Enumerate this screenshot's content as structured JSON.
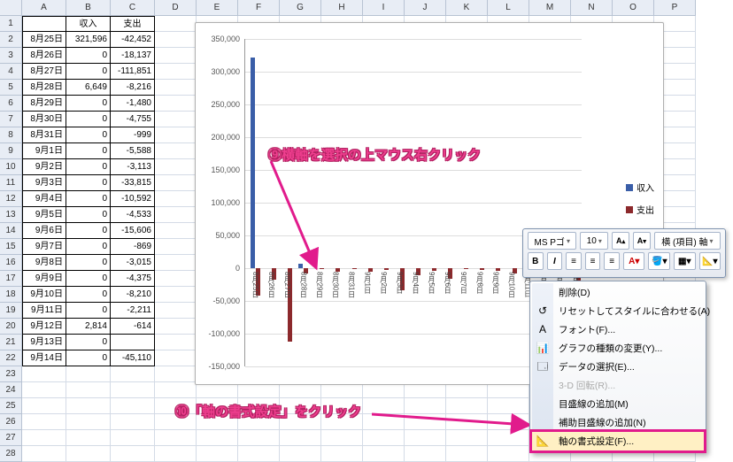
{
  "columns": [
    "A",
    "B",
    "C",
    "D",
    "E",
    "F",
    "G",
    "H",
    "I",
    "J",
    "K",
    "L",
    "M",
    "N",
    "O",
    "P"
  ],
  "row_start": 1,
  "row_end": 28,
  "table": {
    "headers": [
      "",
      "収入",
      "支出"
    ],
    "rows": [
      [
        "8月25日",
        "321,596",
        "-42,452"
      ],
      [
        "8月26日",
        "0",
        "-18,137"
      ],
      [
        "8月27日",
        "0",
        "-111,851"
      ],
      [
        "8月28日",
        "6,649",
        "-8,216"
      ],
      [
        "8月29日",
        "0",
        "-1,480"
      ],
      [
        "8月30日",
        "0",
        "-4,755"
      ],
      [
        "8月31日",
        "0",
        "-999"
      ],
      [
        "9月1日",
        "0",
        "-5,588"
      ],
      [
        "9月2日",
        "0",
        "-3,113"
      ],
      [
        "9月3日",
        "0",
        "-33,815"
      ],
      [
        "9月4日",
        "0",
        "-10,592"
      ],
      [
        "9月5日",
        "0",
        "-4,533"
      ],
      [
        "9月6日",
        "0",
        "-15,606"
      ],
      [
        "9月7日",
        "0",
        "-869"
      ],
      [
        "9月8日",
        "0",
        "-3,015"
      ],
      [
        "9月9日",
        "0",
        "-4,375"
      ],
      [
        "9月10日",
        "0",
        "-8,210"
      ],
      [
        "9月11日",
        "0",
        "-2,211"
      ],
      [
        "9月12日",
        "2,814",
        "-614"
      ],
      [
        "9月13日",
        "0",
        ""
      ],
      [
        "9月14日",
        "0",
        "-45,110"
      ]
    ]
  },
  "legend": {
    "income": "収入",
    "expense": "支出"
  },
  "minitoolbar": {
    "font_name": "MS Pゴ",
    "font_size": "10",
    "axis_label": "横 (項目) 軸"
  },
  "context_menu": {
    "items": [
      {
        "label": "削除(D)",
        "icon": ""
      },
      {
        "label": "リセットしてスタイルに合わせる(A)",
        "icon": "↺"
      },
      {
        "label": "フォント(F)...",
        "icon": "A"
      },
      {
        "label": "グラフの種類の変更(Y)...",
        "icon": "📊"
      },
      {
        "label": "データの選択(E)...",
        "icon": "🗔"
      },
      {
        "label": "3-D 回転(R)...",
        "icon": "",
        "disabled": true
      },
      {
        "label": "目盛線の追加(M)",
        "icon": ""
      },
      {
        "label": "補助目盛線の追加(N)",
        "icon": ""
      },
      {
        "label": "軸の書式設定(F)...",
        "icon": "📐",
        "highlight": true
      }
    ]
  },
  "callouts": {
    "step9": "⑨横軸を選択の上マウス右クリック",
    "step10": "⑩「軸の書式設定」をクリック"
  },
  "chart_data": {
    "type": "bar",
    "categories": [
      "8月25日",
      "8月26日",
      "8月27日",
      "8月28日",
      "8月29日",
      "8月30日",
      "8月31日",
      "9月1日",
      "9月2日",
      "9月3日",
      "9月4日",
      "9月5日",
      "9月6日",
      "9月7日",
      "9月8日",
      "9月9日",
      "9月10日",
      "9月11日",
      "9月12日",
      "9月13日",
      "9月14日"
    ],
    "series": [
      {
        "name": "収入",
        "values": [
          321596,
          0,
          0,
          6649,
          0,
          0,
          0,
          0,
          0,
          0,
          0,
          0,
          0,
          0,
          0,
          0,
          0,
          0,
          2814,
          0,
          0
        ],
        "color": "#3a5ea8"
      },
      {
        "name": "支出",
        "values": [
          -42452,
          -18137,
          -111851,
          -8216,
          -1480,
          -4755,
          -999,
          -5588,
          -3113,
          -33815,
          -10592,
          -4533,
          -15606,
          -869,
          -3015,
          -4375,
          -8210,
          -2211,
          -614,
          0,
          -45110
        ],
        "color": "#8c292c"
      }
    ],
    "ylim": [
      -150000,
      350000
    ],
    "yticks": [
      -150000,
      -100000,
      -50000,
      0,
      50000,
      100000,
      150000,
      200000,
      250000,
      300000,
      350000
    ],
    "xlabel": "",
    "ylabel": "",
    "title": ""
  }
}
